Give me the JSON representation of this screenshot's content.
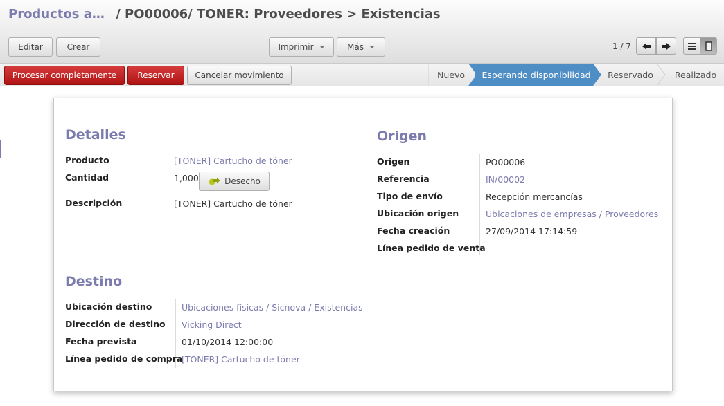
{
  "breadcrumb": {
    "parent": "Productos a…",
    "separator": "/",
    "current": "PO00006/ TONER: Proveedores > Existencias"
  },
  "toolbar": {
    "edit_label": "Editar",
    "create_label": "Crear",
    "print_label": "Imprimir",
    "more_label": "Más",
    "pager_text": "1 / 7"
  },
  "actions": {
    "process_all": "Procesar completamente",
    "reserve": "Reservar",
    "cancel_move": "Cancelar movimiento"
  },
  "stages": [
    "Nuevo",
    "Esperando disponibilidad",
    "Reservado",
    "Realizado"
  ],
  "active_stage": "Esperando disponibilidad",
  "details": {
    "title": "Detalles",
    "product_label": "Producto",
    "product_value": "[TONER] Cartucho de tóner",
    "quantity_label": "Cantidad",
    "quantity_value": "1,000",
    "scrap_label": "Desecho",
    "description_label": "Descripción",
    "description_value": "[TONER] Cartucho de tóner"
  },
  "origin": {
    "title": "Origen",
    "origin_label": "Origen",
    "origin_value": "PO00006",
    "reference_label": "Referencia",
    "reference_value": "IN/00002",
    "shipping_type_label": "Tipo de envío",
    "shipping_type_value": "Recepción mercancías",
    "source_location_label": "Ubicación origen",
    "source_location_value": "Ubicaciones de empresas / Proveedores",
    "creation_date_label": "Fecha creación",
    "creation_date_value": "27/09/2014 17:14:59",
    "sale_line_label": "Línea pedido de venta",
    "sale_line_value": ""
  },
  "destination": {
    "title": "Destino",
    "dest_location_label": "Ubicación destino",
    "dest_location_value": "Ubicaciones físicas / Sicnova / Existencias",
    "dest_address_label": "Dirección de destino",
    "dest_address_value": "Vicking Direct",
    "expected_date_label": "Fecha prevista",
    "expected_date_value": "01/10/2014 12:00:00",
    "purchase_line_label": "Línea pedido de compra",
    "purchase_line_value": "[TONER] Cartucho de tóner"
  },
  "colors": {
    "accent": "#7c7bad",
    "active_stage": "#4f8dc5",
    "primary_action": "#c62828"
  }
}
